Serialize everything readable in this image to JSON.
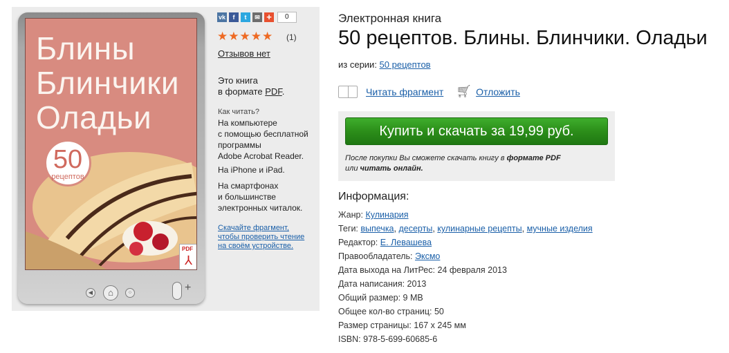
{
  "cover": {
    "title_lines": [
      "Блины",
      "Блинчики",
      "Оладьи"
    ],
    "badge_number": "50",
    "badge_label": "рецептов",
    "pdf_label": "PDF"
  },
  "share": {
    "icons": [
      "vk-icon",
      "facebook-icon",
      "twitter-icon",
      "email-icon",
      "plus-icon"
    ],
    "count": "0"
  },
  "rating": {
    "stars": "★★★★★",
    "count": "(1)"
  },
  "reviews": "Отзывов нет",
  "format": {
    "line1": "Это книга",
    "line2_prefix": "в формате ",
    "pdf": "PDF",
    "line2_suffix": "."
  },
  "how_read": {
    "heading": "Как читать?",
    "p1": [
      "На компьютере",
      "с помощью бесплатной",
      "программы",
      "Adobe Acrobat Reader."
    ],
    "p2": "На iPhone и iPad.",
    "p3": [
      "На смартфонах",
      "и большинстве",
      "электронных читалок."
    ],
    "link_lines": [
      "Скачайте фрагмент,",
      "чтобы проверить чтение",
      "на своём устройстве."
    ]
  },
  "book": {
    "kind": "Электронная книга",
    "title": "50 рецептов. Блины. Блинчики. Оладьи",
    "series_label": "из серии: ",
    "series": "50 рецептов"
  },
  "actions": {
    "read": "Читать фрагмент",
    "defer": "Отложить"
  },
  "buy": {
    "button": "Купить и скачать за 19,99 руб.",
    "note_line1_a": "После покупки Вы сможете скачать книгу в ",
    "note_line1_b": "формате PDF",
    "note_line2_a": "или ",
    "note_line2_b": "читать онлайн."
  },
  "info": {
    "heading": "Информация:",
    "genre_label": "Жанр: ",
    "genre": "Кулинария",
    "tags_label": "Теги: ",
    "tags": [
      "выпечка",
      "десерты",
      "кулинарные рецепты",
      "мучные изделия"
    ],
    "editor_label": "Редактор: ",
    "editor": "Е. Левашева",
    "rights_label": "Правообладатель: ",
    "rights": "Эксмо",
    "release": "Дата выхода на ЛитРес: 24 февраля 2013",
    "written": "Дата написания: 2013",
    "size": "Общий размер: 9 MB",
    "pages": "Общее кол-во страниц: 50",
    "page_size": "Размер страницы: 167 x 245 мм",
    "isbn": "ISBN: 978-5-699-60685-6"
  }
}
